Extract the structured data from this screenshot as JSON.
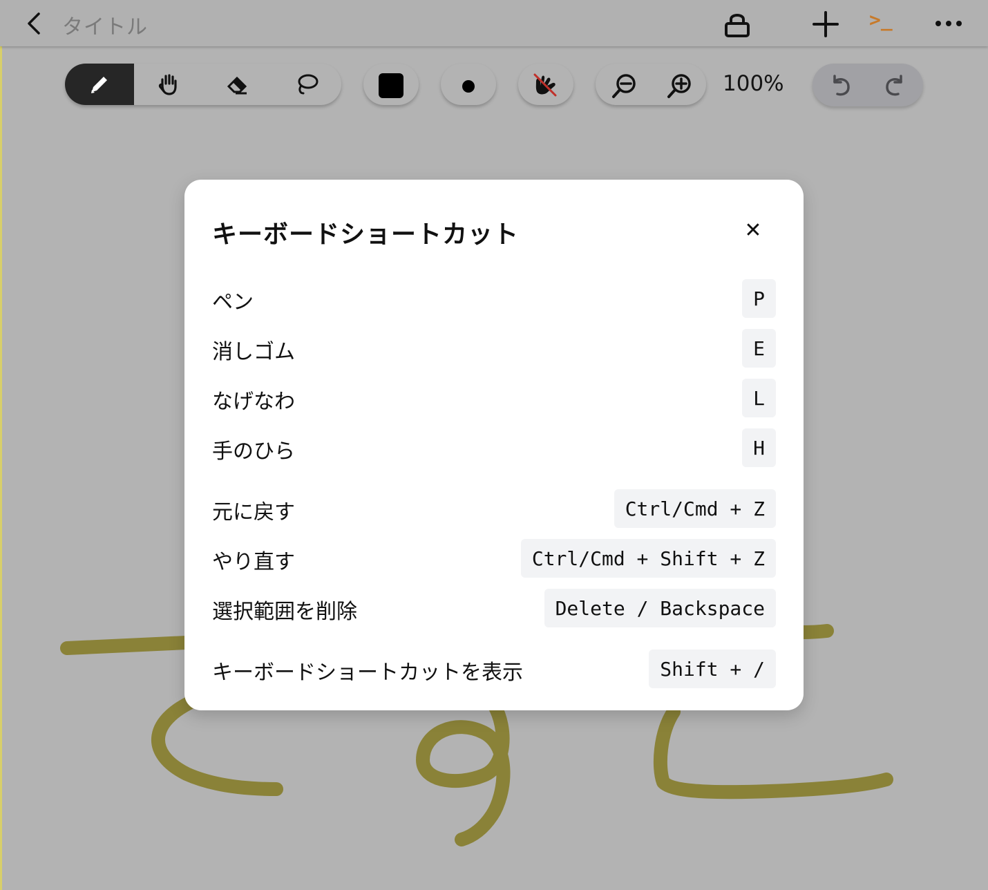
{
  "topbar": {
    "title": "タイトル",
    "icons": [
      "back-icon",
      "lock-icon",
      "add-icon",
      "terminal-icon",
      "more-icon"
    ],
    "terminal_glyph": ">_"
  },
  "toolbar": {
    "tools": [
      "pen-icon",
      "hand-icon",
      "eraser-icon",
      "lasso-icon"
    ],
    "active_tool": "pen",
    "color_icon": "color-swatch-icon",
    "size_icon": "stroke-size-icon",
    "palm_icon": "palm-rejection-off-icon",
    "zoom_level": "100%"
  },
  "modal": {
    "title": "キーボードショートカット",
    "close_glyph": "✕",
    "shortcuts": [
      {
        "label": "ペン",
        "key": "P"
      },
      {
        "label": "消しゴム",
        "key": "E"
      },
      {
        "label": "なげなわ",
        "key": "L"
      },
      {
        "label": "手のひら",
        "key": "H"
      },
      {
        "label": "元に戻す",
        "key": "Ctrl/Cmd + Z"
      },
      {
        "label": "やり直す",
        "key": "Ctrl/Cmd + Shift + Z"
      },
      {
        "label": "選択範囲を削除",
        "key": "Delete / Backspace"
      },
      {
        "label": "キーボードショートカットを表示",
        "key": "Shift + /"
      }
    ]
  },
  "colors": {
    "stroke": "#8a8238",
    "active_tool_bg": "#262626",
    "terminal_accent": "#c77a2a"
  }
}
